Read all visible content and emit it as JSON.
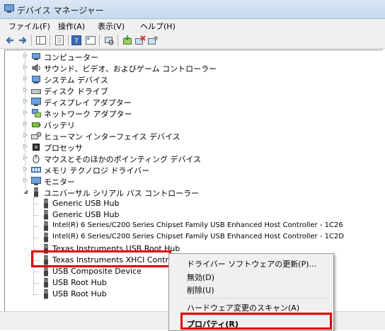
{
  "window": {
    "title": "デバイス マネージャー"
  },
  "menu": [
    "ファイル(F)",
    "操作(A)",
    "表示(V)",
    "ヘルプ(H)"
  ],
  "tree": {
    "categories": [
      "コンピューター",
      "サウンド、ビデオ、およびゲーム コントローラー",
      "システム デバイス",
      "ディスク ドライブ",
      "ディスプレイ アダプター",
      "ネットワーク アダプター",
      "バッテリ",
      "ヒューマン インターフェイス デバイス",
      "プロセッサ",
      "マウスとそのほかのポインティング デバイス",
      "メモリ テクノロジ ドライバー",
      "モニター",
      "ユニバーサル シリアル バス コントローラー"
    ],
    "usb_children": [
      "Generic USB Hub",
      "Generic USB Hub",
      "Intel(R) 6 Series/C200 Series Chipset Family USB Enhanced Host Controller - 1C26",
      "Intel(R) 6 Series/C200 Series Chipset Family USB Enhanced Host Controller - 1C2D",
      "Texas Instruments USB Root Hub",
      "Texas Instruments XHCI Controller",
      "USB Composite Device",
      "USB Root Hub",
      "USB Root Hub"
    ]
  },
  "context_menu": {
    "items": [
      "ドライバー ソフトウェアの更新(P)...",
      "無効(D)",
      "削除(U)",
      "ハードウェア変更のスキャン(A)",
      "プロパティ(R)"
    ]
  },
  "colors": {
    "highlight_red": "#e00000"
  }
}
